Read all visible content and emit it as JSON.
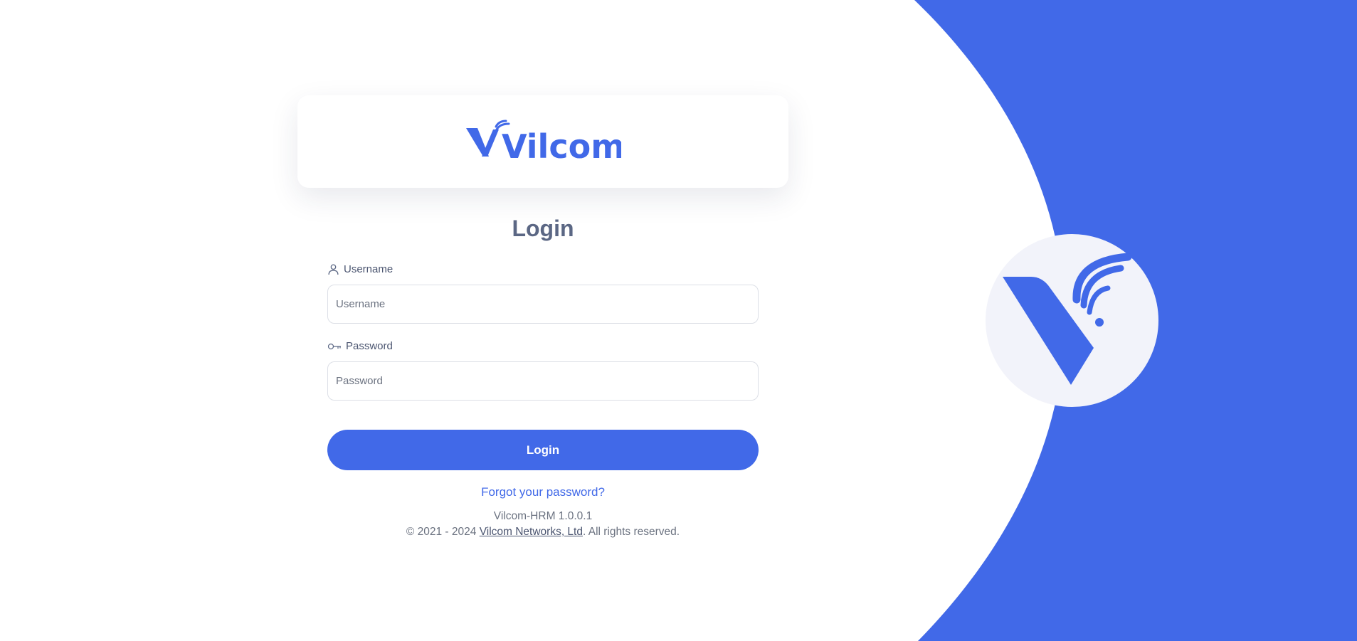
{
  "brand": {
    "logo_text": "Vilcom",
    "accent_color": "#4169e8",
    "background_shape_color": "#4169e8",
    "badge_color": "#f2f3fa"
  },
  "form": {
    "title": "Login",
    "username": {
      "icon": "user-icon",
      "label": "Username",
      "placeholder": "Username",
      "value": ""
    },
    "password": {
      "icon": "key-icon",
      "label": "Password",
      "placeholder": "Password",
      "value": ""
    },
    "submit_label": "Login",
    "forgot_link": "Forgot your password?"
  },
  "footer": {
    "version": "Vilcom-HRM 1.0.0.1",
    "copyright_prefix": "© 2021 - 2024 ",
    "company_link": "Vilcom Networks, Ltd",
    "copyright_suffix": ". All rights reserved."
  }
}
